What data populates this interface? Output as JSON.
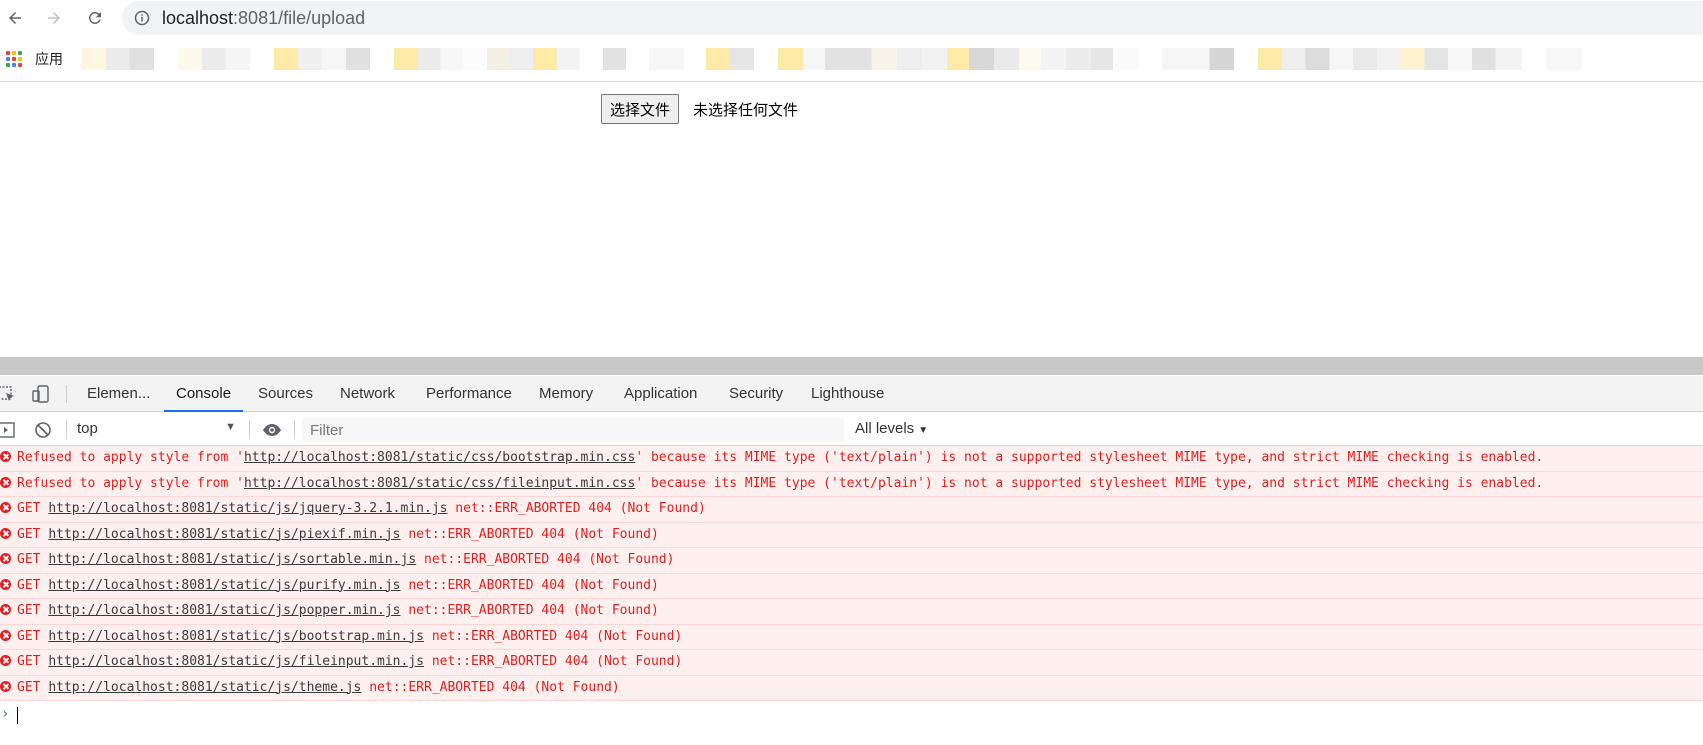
{
  "browser": {
    "url_host": "localhost",
    "url_rest": ":8081/file/upload",
    "bookmarks_apps_label": "应用",
    "apps_grid_colors": [
      "#ea4335",
      "#fbbc04",
      "#34a853",
      "#4285f4",
      "#ea4335",
      "#fbbc04",
      "#34a853",
      "#4285f4",
      "#ea4335"
    ],
    "icons": [
      "back-icon",
      "forward-icon",
      "reload-icon",
      "info-icon",
      "apps-icon"
    ]
  },
  "page": {
    "file_button_label": "选择文件",
    "file_status": "未选择任何文件"
  },
  "devtools": {
    "tabs": [
      "Elemen...",
      "Console",
      "Sources",
      "Network",
      "Performance",
      "Memory",
      "Application",
      "Security",
      "Lighthouse"
    ],
    "active_tab": "Console",
    "context": "top",
    "filter_placeholder": "Filter",
    "levels_label": "All levels",
    "accent_color": "#1a73e8",
    "error_color": "#e02020",
    "messages": [
      {
        "before": "Refused to apply style from '",
        "link": "http://localhost:8081/static/css/bootstrap.min.css",
        "after": "' because its MIME type ('text/plain') is not a supported stylesheet MIME type, and strict MIME checking is enabled."
      },
      {
        "before": "Refused to apply style from '",
        "link": "http://localhost:8081/static/css/fileinput.min.css",
        "after": "' because its MIME type ('text/plain') is not a supported stylesheet MIME type, and strict MIME checking is enabled."
      },
      {
        "before": "GET ",
        "link": "http://localhost:8081/static/js/jquery-3.2.1.min.js",
        "after": " net::ERR_ABORTED 404 (Not Found)"
      },
      {
        "before": "GET ",
        "link": "http://localhost:8081/static/js/piexif.min.js",
        "after": " net::ERR_ABORTED 404 (Not Found)"
      },
      {
        "before": "GET ",
        "link": "http://localhost:8081/static/js/sortable.min.js",
        "after": " net::ERR_ABORTED 404 (Not Found)"
      },
      {
        "before": "GET ",
        "link": "http://localhost:8081/static/js/purify.min.js",
        "after": " net::ERR_ABORTED 404 (Not Found)"
      },
      {
        "before": "GET ",
        "link": "http://localhost:8081/static/js/popper.min.js",
        "after": " net::ERR_ABORTED 404 (Not Found)"
      },
      {
        "before": "GET ",
        "link": "http://localhost:8081/static/js/bootstrap.min.js",
        "after": " net::ERR_ABORTED 404 (Not Found)"
      },
      {
        "before": "GET ",
        "link": "http://localhost:8081/static/js/fileinput.min.js",
        "after": " net::ERR_ABORTED 404 (Not Found)"
      },
      {
        "before": "GET ",
        "link": "http://localhost:8081/static/js/theme.js",
        "after": " net::ERR_ABORTED 404 (Not Found)"
      }
    ]
  }
}
